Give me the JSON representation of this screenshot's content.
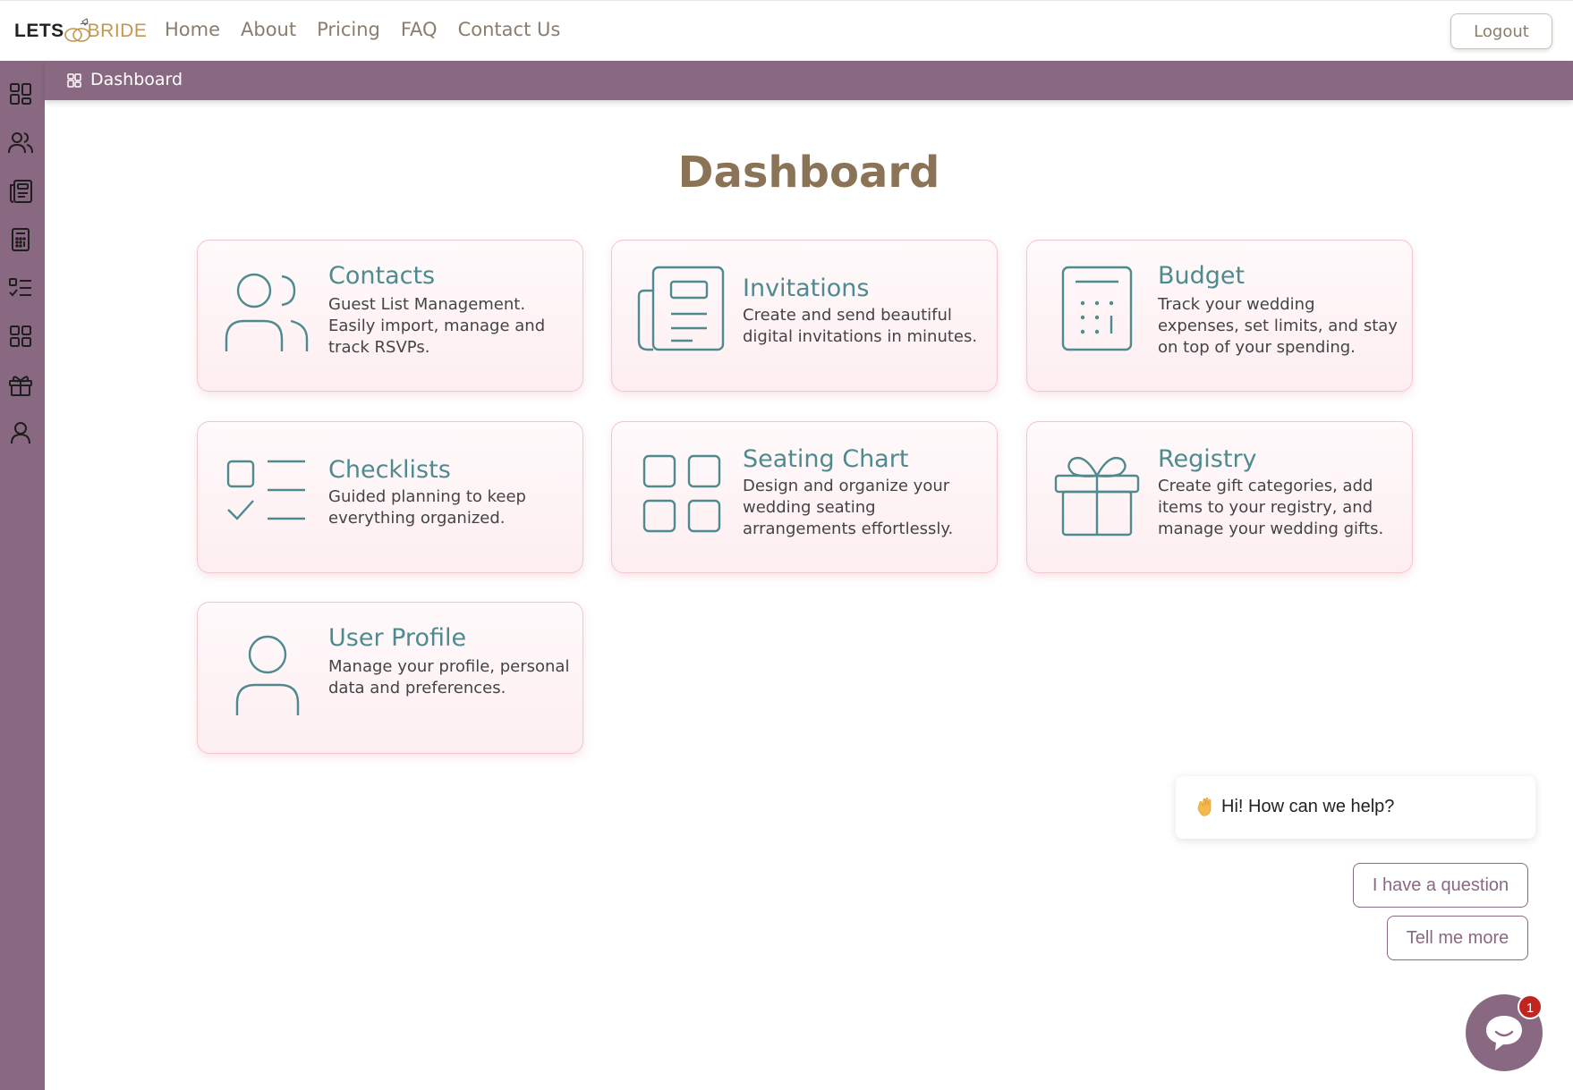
{
  "brand": {
    "logo_left": "LETS",
    "logo_right": "BRIDE",
    "accent": "#896981",
    "teal": "#4f8a8e",
    "gold": "#8a7356"
  },
  "nav": {
    "links": [
      "Home",
      "About",
      "Pricing",
      "FAQ",
      "Contact Us"
    ],
    "logout_label": "Logout"
  },
  "sidebar": {
    "items": [
      {
        "icon": "dashboard-icon"
      },
      {
        "icon": "contacts-icon"
      },
      {
        "icon": "invitations-icon"
      },
      {
        "icon": "budget-icon"
      },
      {
        "icon": "checklists-icon"
      },
      {
        "icon": "seating-chart-icon"
      },
      {
        "icon": "registry-icon"
      },
      {
        "icon": "user-profile-icon"
      }
    ]
  },
  "breadcrumb": {
    "label": "Dashboard"
  },
  "main": {
    "title": "Dashboard",
    "cards": [
      {
        "title": "Contacts",
        "description": "Guest List Management. Easily import, manage and track RSVPs.",
        "icon": "contacts-icon"
      },
      {
        "title": "Invitations",
        "description": "Create and send beautiful digital invitations in minutes.",
        "icon": "invitations-icon"
      },
      {
        "title": "Budget",
        "description": "Track your wedding expenses, set limits, and stay on top of your spending.",
        "icon": "budget-icon"
      },
      {
        "title": "Checklists",
        "description": "Guided planning to keep everything organized.",
        "icon": "checklists-icon"
      },
      {
        "title": "Seating Chart",
        "description": "Design and organize your wedding seating arrangements effortlessly.",
        "icon": "seating-chart-icon"
      },
      {
        "title": "Registry",
        "description": "Create gift categories, add items to your registry, and manage your wedding gifts.",
        "icon": "registry-icon"
      },
      {
        "title": "User Profile",
        "description": "Manage your profile, personal data and preferences.",
        "icon": "user-profile-icon"
      }
    ]
  },
  "chat": {
    "greeting": "Hi! How can we help?",
    "options": [
      "I have a question",
      "Tell me more"
    ],
    "badge_count": "1"
  }
}
